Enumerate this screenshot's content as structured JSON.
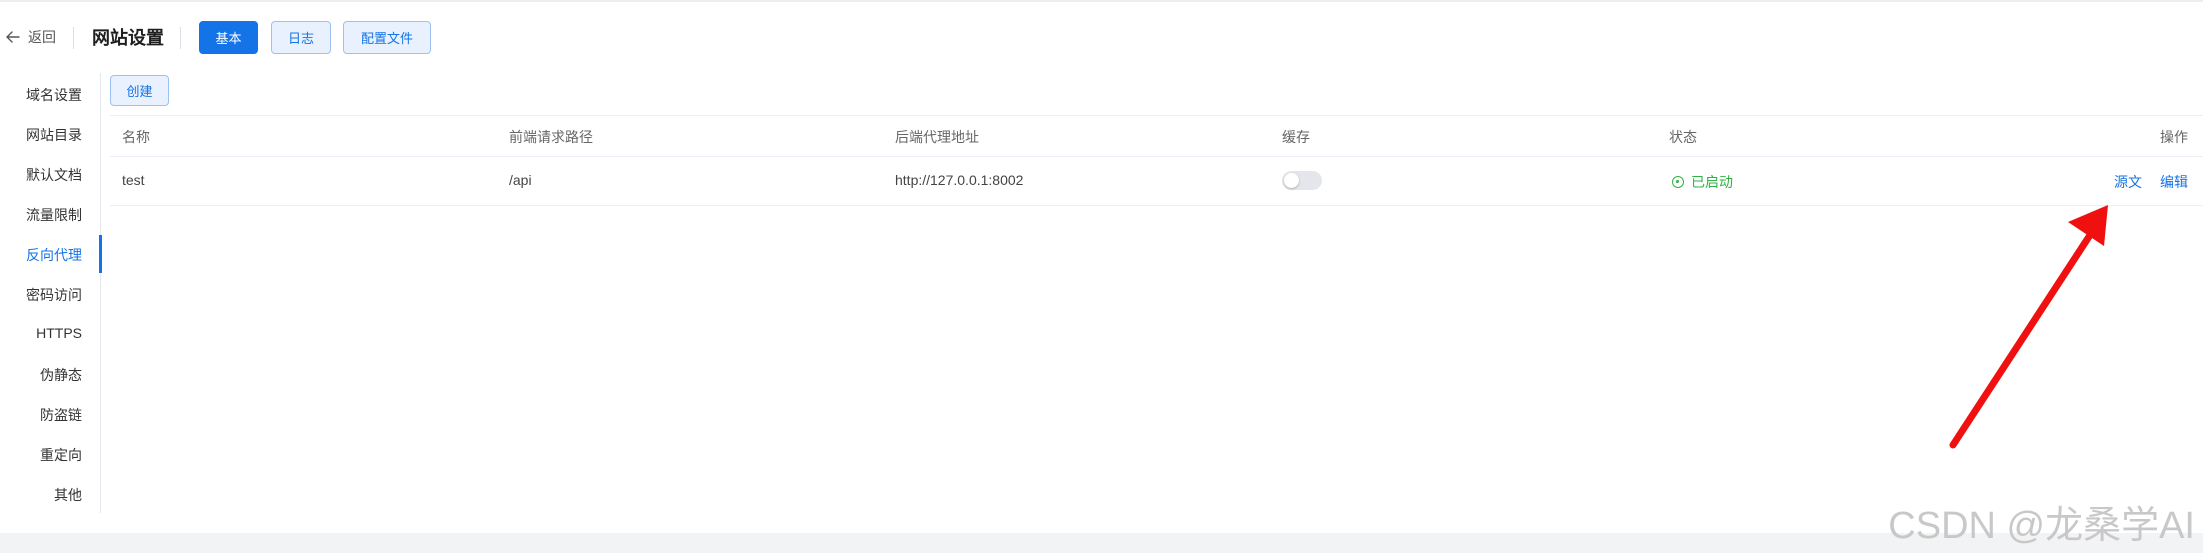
{
  "header": {
    "back_label": "返回",
    "title": "网站设置",
    "tabs": [
      {
        "label": "基本",
        "active": true
      },
      {
        "label": "日志",
        "active": false
      },
      {
        "label": "配置文件",
        "active": false
      }
    ]
  },
  "sidebar": {
    "active_index": 4,
    "items": [
      {
        "label": "域名设置"
      },
      {
        "label": "网站目录"
      },
      {
        "label": "默认文档"
      },
      {
        "label": "流量限制"
      },
      {
        "label": "反向代理"
      },
      {
        "label": "密码访问"
      },
      {
        "label": "HTTPS"
      },
      {
        "label": "伪静态"
      },
      {
        "label": "防盗链"
      },
      {
        "label": "重定向"
      },
      {
        "label": "其他"
      }
    ]
  },
  "toolbar": {
    "create_label": "创建"
  },
  "table": {
    "columns": [
      "名称",
      "前端请求路径",
      "后端代理地址",
      "缓存",
      "状态",
      "操作"
    ],
    "rows": [
      {
        "name": "test",
        "frontend_path": "/api",
        "backend_address": "http://127.0.0.1:8002",
        "cache_enabled": false,
        "status": "已启动",
        "actions": [
          "源文",
          "编辑"
        ]
      }
    ]
  },
  "watermark": "CSDN @龙桑学AI",
  "colors": {
    "accent": "#1473e6",
    "status_ok": "#2fb344",
    "annotation_arrow": "#f01010"
  }
}
